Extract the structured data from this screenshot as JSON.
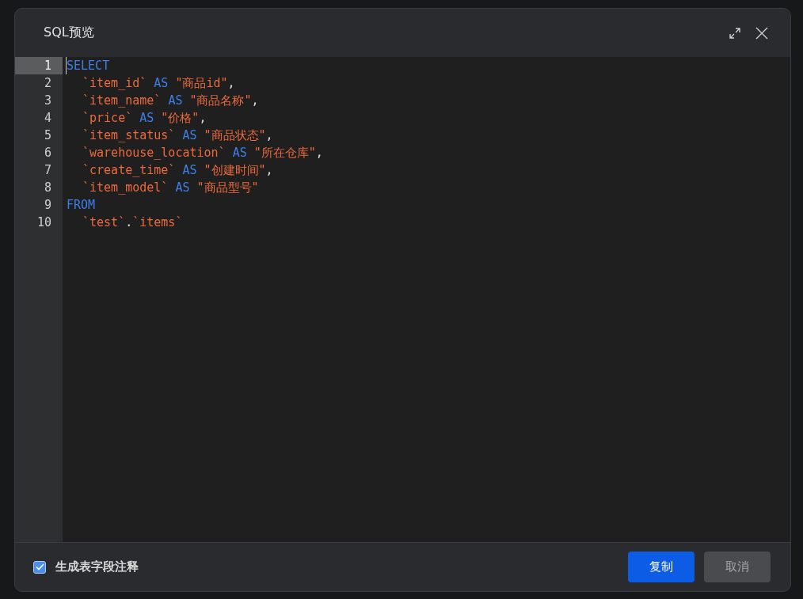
{
  "dialog": {
    "title": "SQL预览"
  },
  "editor": {
    "lines": [
      {
        "number": "1",
        "current": true,
        "indented": false,
        "tokens": [
          {
            "kind": "keyword",
            "text": "SELECT"
          }
        ]
      },
      {
        "number": "2",
        "current": false,
        "indented": true,
        "tokens": [
          {
            "kind": "ident",
            "text": "`item_id`"
          },
          {
            "kind": "keyword",
            "text": "AS"
          },
          {
            "kind": "string",
            "text": "\"商品id\""
          },
          {
            "kind": "punct",
            "text": ","
          }
        ]
      },
      {
        "number": "3",
        "current": false,
        "indented": true,
        "tokens": [
          {
            "kind": "ident",
            "text": "`item_name`"
          },
          {
            "kind": "keyword",
            "text": "AS"
          },
          {
            "kind": "string",
            "text": "\"商品名称\""
          },
          {
            "kind": "punct",
            "text": ","
          }
        ]
      },
      {
        "number": "4",
        "current": false,
        "indented": true,
        "tokens": [
          {
            "kind": "ident",
            "text": "`price`"
          },
          {
            "kind": "keyword",
            "text": "AS"
          },
          {
            "kind": "string",
            "text": "\"价格\""
          },
          {
            "kind": "punct",
            "text": ","
          }
        ]
      },
      {
        "number": "5",
        "current": false,
        "indented": true,
        "tokens": [
          {
            "kind": "ident",
            "text": "`item_status`"
          },
          {
            "kind": "keyword",
            "text": "AS"
          },
          {
            "kind": "string",
            "text": "\"商品状态\""
          },
          {
            "kind": "punct",
            "text": ","
          }
        ]
      },
      {
        "number": "6",
        "current": false,
        "indented": true,
        "tokens": [
          {
            "kind": "ident",
            "text": "`warehouse_location`"
          },
          {
            "kind": "keyword",
            "text": "AS"
          },
          {
            "kind": "string",
            "text": "\"所在仓库\""
          },
          {
            "kind": "punct",
            "text": ","
          }
        ]
      },
      {
        "number": "7",
        "current": false,
        "indented": true,
        "tokens": [
          {
            "kind": "ident",
            "text": "`create_time`"
          },
          {
            "kind": "keyword",
            "text": "AS"
          },
          {
            "kind": "string",
            "text": "\"创建时间\""
          },
          {
            "kind": "punct",
            "text": ","
          }
        ]
      },
      {
        "number": "8",
        "current": false,
        "indented": true,
        "tokens": [
          {
            "kind": "ident",
            "text": "`item_model`"
          },
          {
            "kind": "keyword",
            "text": "AS"
          },
          {
            "kind": "string",
            "text": "\"商品型号\""
          }
        ]
      },
      {
        "number": "9",
        "current": false,
        "indented": false,
        "tokens": [
          {
            "kind": "keyword",
            "text": "FROM"
          }
        ]
      },
      {
        "number": "10",
        "current": false,
        "indented": true,
        "tokens": [
          {
            "kind": "ident",
            "text": "`test`"
          },
          {
            "kind": "sep",
            "text": "."
          },
          {
            "kind": "ident",
            "text": "`items`"
          }
        ]
      }
    ]
  },
  "footer": {
    "option": {
      "label": "生成表字段注释",
      "checked": true
    },
    "buttons": [
      {
        "kind": "primary",
        "label": "复制"
      },
      {
        "kind": "secondary",
        "label": "取消"
      }
    ]
  }
}
